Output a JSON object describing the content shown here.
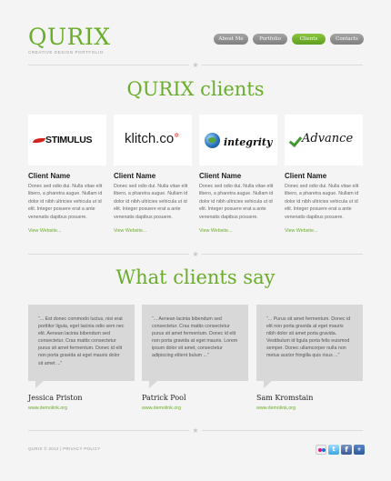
{
  "header": {
    "logo": "QURIX",
    "tagline": "CREATIVE DESIGN PORTFOLIO",
    "nav": [
      {
        "label": "About Me",
        "active": false
      },
      {
        "label": "Portfolio",
        "active": false
      },
      {
        "label": "Clients",
        "active": true
      },
      {
        "label": "Contacts",
        "active": false
      }
    ]
  },
  "clients_section": {
    "title": "QURIX clients",
    "clients": [
      {
        "logo_text": "STIMULUS",
        "name": "Client Name",
        "description": "Donec sed odio dui. Nulla vitae elit libero, a pharetra augue. Nullam id dolor id nibh ultricies vehicula ut id elit. Integer posuere erat a ante venenatis dapibus posuere.",
        "link": "View Website..."
      },
      {
        "logo_text": "klitch.co",
        "name": "Client Name",
        "description": "Donec sed odio dui. Nulla vitae elit libero, a pharetra augue. Nullam id dolor id nibh ultricies vehicula ut id elit. Integer posuere erat a ante venenatis dapibus posuere.",
        "link": "View Website..."
      },
      {
        "logo_text": "integrity",
        "name": "Client Name",
        "description": "Donec sed odio dui. Nulla vitae elit libero, a pharetra augue. Nullam id dolor id nibh ultricies vehicula ut id elit. Integer posuere erat a ante venenatis dapibus posuere.",
        "link": "View Website..."
      },
      {
        "logo_text": "Advance",
        "name": "Client Name",
        "description": "Donec sed odio dui. Nulla vitae elit libero, a pharetra augue. Nullam id dolor id nibh ultricies vehicula ut id elit. Integer posuere erat a ante venenatis dapibus posuere.",
        "link": "View Website..."
      }
    ]
  },
  "testimonials_section": {
    "title": "What clients say",
    "testimonials": [
      {
        "quote": "“... Est donec commodo luctus, nisi erat porttitor ligula, eget lacinia odio sem nec elit. Aenean lacinia bibendum sed consectetur. Cras mattis consectetur purus sit amet fermentum. Donec id elit non porta gravida at eget mauris dolor sit amet ...”",
        "name": "Jessica Priston",
        "link": "www.demolink.org"
      },
      {
        "quote": "“... Aenean lacinia bibendum sed consectetur. Cras mattis consectetur purus sit amet fermentum. Donec id elit non porta gravida at eget mauris. Lorem ipsum dolor sit amet, consectetur adipiscing elitent bulum ...”",
        "name": "Patrick Pool",
        "link": "www.demolink.org"
      },
      {
        "quote": "“... Purus sit amet fermentum. Donec id elit non porta gravida at eget mauris nibh dolor sit amet porta gravida. Vestibulum id ligula porta felis euismod semper. Donec ullamcorper nulla non metus auctor fringilla quis risus ...”",
        "name": "Sam Kromstain",
        "link": "www.demolink.org"
      }
    ]
  },
  "footer": {
    "copyright": "QURIX © 2012 | PRIVACY POLICY",
    "social_icons": [
      "flickr-icon",
      "twitter-icon",
      "facebook-icon",
      "share-icon"
    ]
  },
  "colors": {
    "accent": "#6aad2a",
    "background": "#f4f4f4",
    "bubble": "#d8d8d8",
    "nav_inactive": "#8a8a8a"
  }
}
